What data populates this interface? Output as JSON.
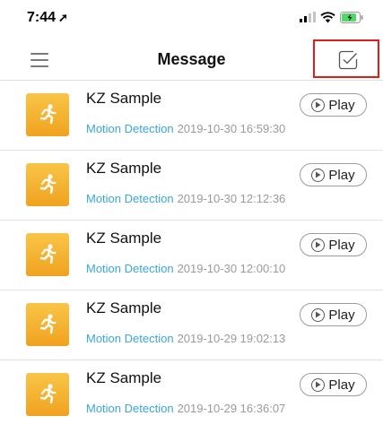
{
  "status_bar": {
    "time": "7:44",
    "location_glyph": "➚",
    "icons": [
      "signal-icon",
      "wifi-icon",
      "battery-charging-icon"
    ]
  },
  "nav": {
    "title": "Message",
    "left_icon": "menu-icon",
    "right_icon": "select-checkbox-icon"
  },
  "colors": {
    "accent": "#3aa6dc",
    "highlight_box": "#e31b1b",
    "thumb_top": "#f9c547",
    "thumb_bottom": "#f0a21f"
  },
  "messages": [
    {
      "device": "KZ Sample",
      "type": "Motion Detection",
      "time": "2019-10-30 16:59:30",
      "play_label": "Play",
      "icon": "motion-running-icon"
    },
    {
      "device": "KZ Sample",
      "type": "Motion Detection",
      "time": "2019-10-30 12:12:36",
      "play_label": "Play",
      "icon": "motion-running-icon"
    },
    {
      "device": "KZ Sample",
      "type": "Motion Detection",
      "time": "2019-10-30 12:00:10",
      "play_label": "Play",
      "icon": "motion-running-icon"
    },
    {
      "device": "KZ Sample",
      "type": "Motion Detection",
      "time": "2019-10-29 19:02:13",
      "play_label": "Play",
      "icon": "motion-running-icon"
    },
    {
      "device": "KZ Sample",
      "type": "Motion Detection",
      "time": "2019-10-29 16:36:07",
      "play_label": "Play",
      "icon": "motion-running-icon"
    }
  ]
}
